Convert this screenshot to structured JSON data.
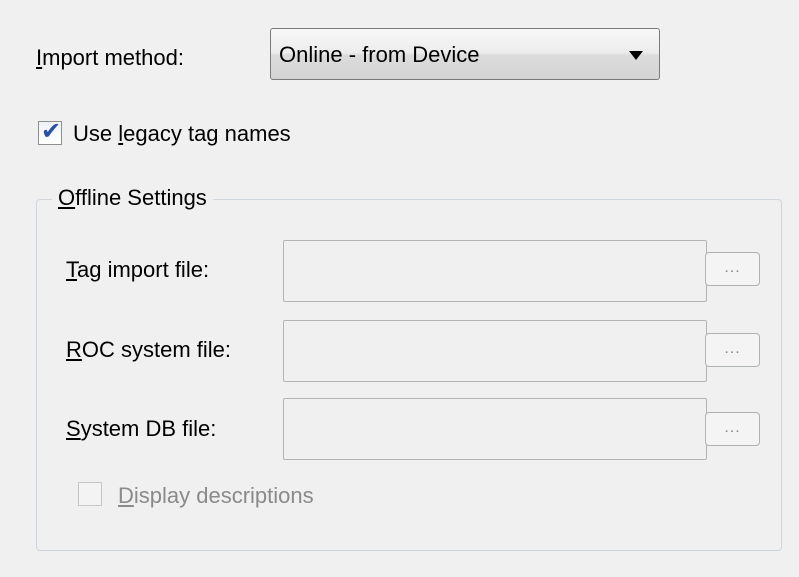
{
  "import_method": {
    "label": "Import method:",
    "underline": "I",
    "label_rest": "mport method:",
    "selected": "Online - from Device"
  },
  "legacy_tags": {
    "checked": true,
    "label_pre": "Use ",
    "underline": "l",
    "label_rest": "egacy tag names"
  },
  "offline_settings": {
    "legend_underline": "O",
    "legend_rest": "ffline Settings",
    "fields": [
      {
        "underline": "T",
        "rest": "ag import file:",
        "value": "",
        "browse_label": "..."
      },
      {
        "underline": "R",
        "rest": "OC system file:",
        "value": "",
        "browse_label": "..."
      },
      {
        "underline": "S",
        "rest": "ystem DB file:",
        "value": "",
        "browse_label": "..."
      }
    ],
    "display_descriptions": {
      "checked": false,
      "enabled": false,
      "underline": "D",
      "rest": "isplay descriptions"
    }
  }
}
